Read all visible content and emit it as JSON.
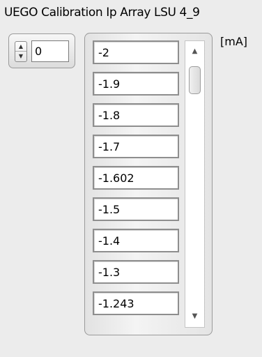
{
  "control": {
    "title": "UEGO Calibration Ip Array LSU 4_9",
    "unit": "[mA]"
  },
  "index": {
    "value": "0",
    "up_icon": "triangle-up-icon",
    "down_icon": "triangle-down-icon"
  },
  "array": {
    "values": [
      "-2",
      "-1.9",
      "-1.8",
      "-1.7",
      "-1.602",
      "-1.5",
      "-1.4",
      "-1.3",
      "-1.243"
    ]
  },
  "scrollbar": {
    "up_icon": "scroll-up-arrow-icon",
    "down_icon": "scroll-down-arrow-icon",
    "up_glyph": "▲",
    "down_glyph": "▼"
  },
  "colors": {
    "background": "#ececec",
    "frame_border": "#9a9a9a",
    "cell_border": "#8e8e8e"
  }
}
